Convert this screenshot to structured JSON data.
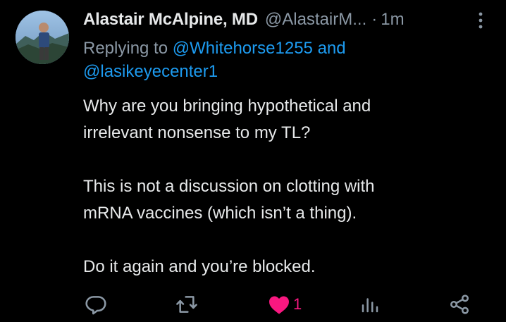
{
  "tweet": {
    "author_name": "Alastair McAlpine, MD",
    "author_handle": "@AlastairM...",
    "separator": "·",
    "time": "1m",
    "reply_prefix": "Replying to",
    "reply_mention_1": "@Whitehorse1255",
    "reply_conjunction": "and",
    "reply_mention_2": "@lasikeyecenter1",
    "body": {
      "line1": "Why are you bringing hypothetical and",
      "line2": "irrelevant nonsense to my TL?",
      "line3": "This is not a discussion on clotting with",
      "line4": "mRNA vaccines (which isn’t a thing).",
      "line5": "Do it again and you’re blocked."
    }
  },
  "actions": {
    "reply_icon": "reply-icon",
    "retweet_icon": "retweet-icon",
    "like_icon": "heart-filled-icon",
    "like_count": "1",
    "views_icon": "views-icon",
    "share_icon": "share-icon"
  },
  "colors": {
    "background": "#000000",
    "text": "#e7e9ea",
    "muted": "#8b98a5",
    "link": "#1d9bf0",
    "like": "#f91880"
  }
}
